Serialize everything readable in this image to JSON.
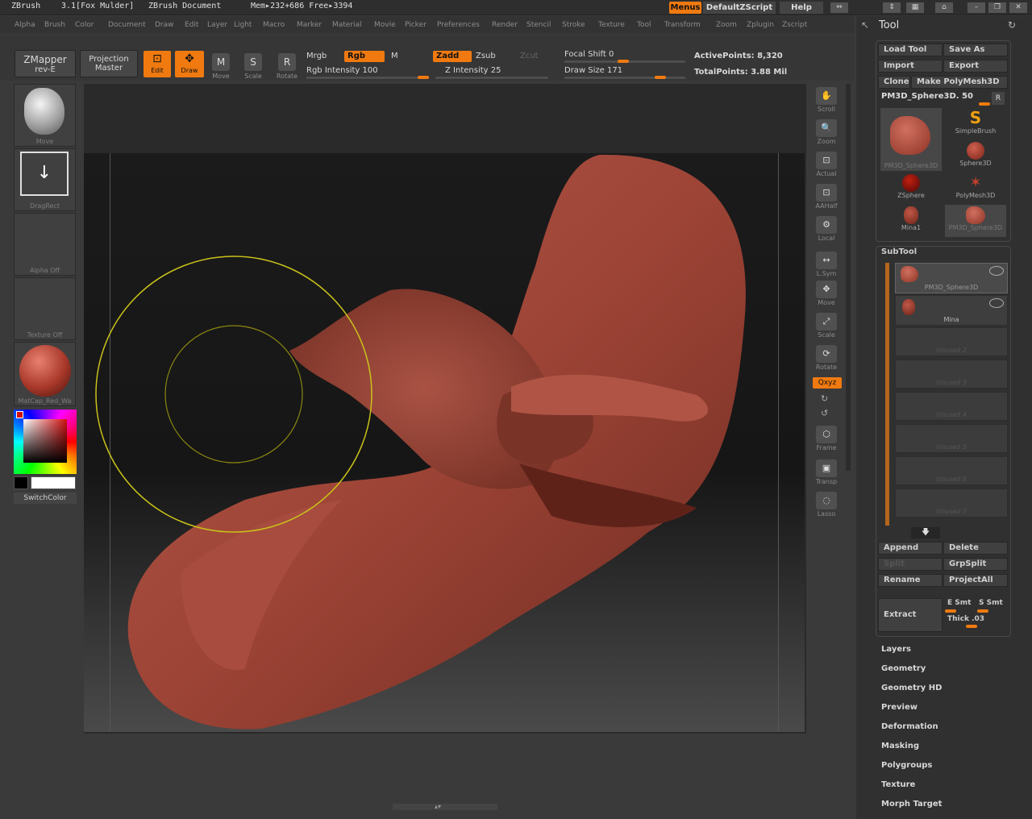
{
  "titlebar": {
    "app": "ZBrush",
    "version": "3.1[Fox Mulder]",
    "document": "ZBrush Document",
    "memory": "Mem▸232+686 Free▸3394",
    "menus": "Menus",
    "script": "DefaultZScript",
    "help": "Help"
  },
  "menubar": [
    "Alpha",
    "Brush",
    "Color",
    "Document",
    "Draw",
    "Edit",
    "Layer",
    "Light",
    "Macro",
    "Marker",
    "Material",
    "Movie",
    "Picker",
    "Preferences",
    "Render",
    "Stencil",
    "Stroke",
    "Texture",
    "Tool",
    "Transform",
    "Zoom",
    "Zplugin",
    "Zscript"
  ],
  "toolbar": {
    "zmapper": "ZMapper",
    "zmapper_sub": "rev-E",
    "projection": "Projection",
    "projection_sub": "Master",
    "edit": "Edit",
    "draw": "Draw",
    "move": "Move",
    "scale": "Scale",
    "rotate": "Rotate",
    "mrgb": "Mrgb",
    "rgb": "Rgb",
    "m": "M",
    "rgb_intensity": "Rgb Intensity 100",
    "zadd": "Zadd",
    "zsub": "Zsub",
    "zcut": "Zcut",
    "z_intensity": "Z Intensity 25",
    "focal_shift": "Focal Shift 0",
    "draw_size": "Draw Size 171",
    "active_points": "ActivePoints: 8,320",
    "total_points": "TotalPoints: 3.88  Mil"
  },
  "shelf": {
    "brush": "Move",
    "stroke": "DragRect",
    "alpha": "Alpha  Off",
    "texture": "Texture  Off",
    "material": "MatCap_Red_Wa",
    "switch_color": "SwitchColor"
  },
  "right_strip": [
    "Scroll",
    "Zoom",
    "Actual",
    "AAHalf",
    "Local",
    "L.Sym",
    "Move",
    "Scale",
    "Rotate",
    "Frame",
    "Transp",
    "Lasso"
  ],
  "xyz": "Qxyz",
  "tool_panel": {
    "title": "Tool",
    "load_tool": "Load Tool",
    "save_as": "Save As",
    "import": "Import",
    "export": "Export",
    "clone": "Clone",
    "make_polymesh": "Make PolyMesh3D",
    "current_tool": "PM3D_Sphere3D. 50",
    "r": "R",
    "thumbs": [
      "PM3D_Sphere3D",
      "SimpleBrush",
      "Sphere3D",
      "ZSphere",
      "PolyMesh3D",
      "Mina1",
      "PM3D_Sphere3D"
    ],
    "subtool_header": "SubTool",
    "subtools": [
      "PM3D_Sphere3D",
      "Mina"
    ],
    "unused": [
      "Unused 2",
      "Unused 3",
      "Unused 4",
      "Unused 5",
      "Unused 6",
      "Unused 7"
    ],
    "append": "Append",
    "delete": "Delete",
    "split": "Split",
    "grpsplit": "GrpSplit",
    "rename": "Rename",
    "projectall": "ProjectAll",
    "extract": "Extract",
    "e_smt": "E Smt",
    "s_smt": "S Smt",
    "thick": "Thick .03",
    "sections": [
      "Layers",
      "Geometry",
      "Geometry HD",
      "Preview",
      "Deformation",
      "Masking",
      "Polygroups",
      "Texture",
      "Morph Target"
    ]
  }
}
